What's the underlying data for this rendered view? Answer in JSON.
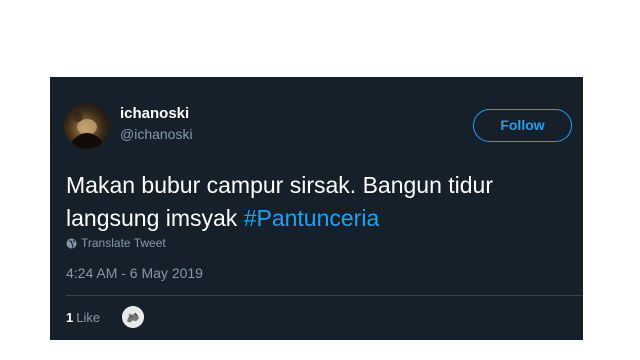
{
  "tweet": {
    "display_name": "ichanoski",
    "handle": "@ichanoski",
    "follow_label": "Follow",
    "text_main": "Makan bubur campur sirsak. Bangun tidur langsung imsyak ",
    "hashtag": "#Pantunceria",
    "translate_label": "Translate Tweet",
    "timestamp": "4:24 AM - 6 May 2019",
    "like_count": "1",
    "like_label": "Like"
  },
  "colors": {
    "background": "#15202b",
    "accent": "#1da1f2",
    "secondary_text": "#8899a6",
    "primary_text": "#ffffff",
    "divider": "#38444d"
  },
  "icons": {
    "avatar": "avatar",
    "translate": "globe-icon",
    "liker": "liker-avatar"
  }
}
